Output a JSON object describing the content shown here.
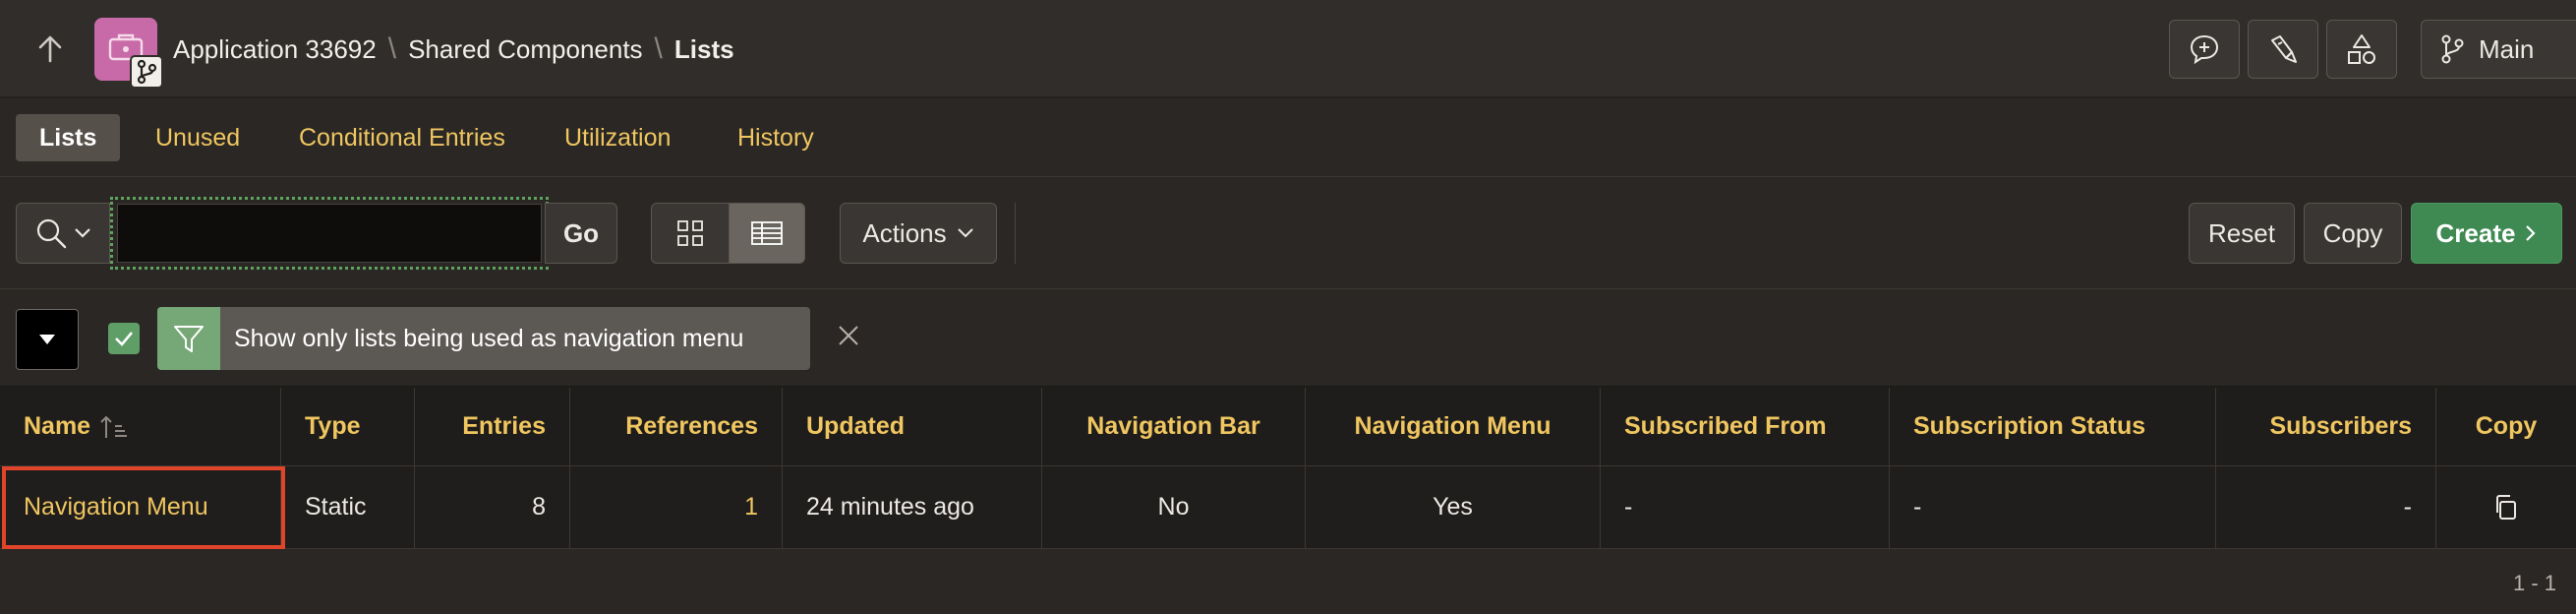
{
  "header": {
    "breadcrumb": [
      "Application 33692",
      "Shared Components",
      "Lists"
    ],
    "branch_label": "Main"
  },
  "tabs": [
    {
      "label": "Lists",
      "active": true
    },
    {
      "label": "Unused",
      "active": false
    },
    {
      "label": "Conditional Entries",
      "active": false
    },
    {
      "label": "Utilization",
      "active": false
    },
    {
      "label": "History",
      "active": false
    }
  ],
  "toolbar": {
    "search_value": "",
    "go_label": "Go",
    "actions_label": "Actions",
    "reset_label": "Reset",
    "copy_label": "Copy",
    "create_label": "Create"
  },
  "filter": {
    "checked": true,
    "label": "Show only lists being used as navigation menu"
  },
  "table": {
    "columns": [
      "Name",
      "Type",
      "Entries",
      "References",
      "Updated",
      "Navigation Bar",
      "Navigation Menu",
      "Subscribed From",
      "Subscription Status",
      "Subscribers",
      "Copy"
    ],
    "rows": [
      {
        "name": "Navigation Menu",
        "type": "Static",
        "entries": "8",
        "references": "1",
        "updated": "24 minutes ago",
        "navigation_bar": "No",
        "navigation_menu": "Yes",
        "subscribed_from": "-",
        "subscription_status": "-",
        "subscribers": "-"
      }
    ]
  },
  "pagination": "1 - 1",
  "colors": {
    "accent_link": "#f0c660",
    "create_button": "#3f8a52",
    "app_logo": "#c96aa8",
    "highlight_box": "#e0442b",
    "filter_icon_bg": "#75a876"
  }
}
